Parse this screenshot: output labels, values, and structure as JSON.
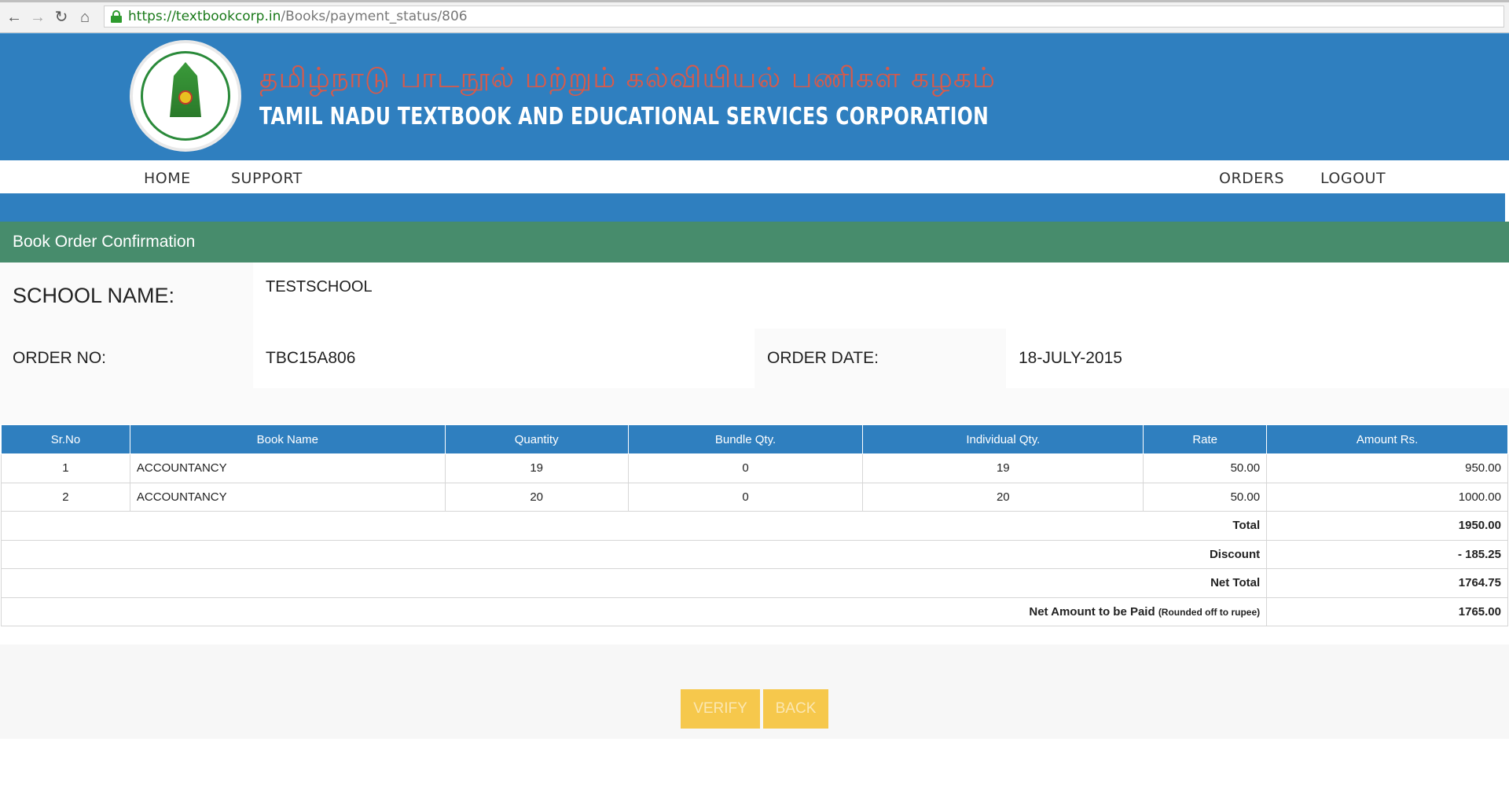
{
  "browser": {
    "url_host": "https://textbookcorp.in",
    "url_path": "/Books/payment_status/806",
    "back_icon": "arrow-left-icon",
    "forward_icon": "arrow-right-icon",
    "reload_icon": "reload-icon",
    "home_icon": "home-icon"
  },
  "header": {
    "title_tamil": "தமிழ்நாடு பாடநூல் மற்றும் கல்வியியல் பணிகள் கழகம்",
    "title_english": "TAMIL NADU TEXTBOOK AND EDUCATIONAL SERVICES CORPORATION"
  },
  "nav": {
    "home": "HOME",
    "support": "SUPPORT",
    "orders": "ORDERS",
    "logout": "LOGOUT"
  },
  "section": {
    "title": "Book Order Confirmation"
  },
  "order": {
    "school_label": "SCHOOL NAME:",
    "school_value": "TESTSCHOOL",
    "order_no_label": "ORDER NO:",
    "order_no_value": "TBC15A806",
    "order_date_label": "ORDER DATE:",
    "order_date_value": "18-JULY-2015"
  },
  "table": {
    "headers": [
      "Sr.No",
      "Book Name",
      "Quantity",
      "Bundle Qty.",
      "Individual Qty.",
      "Rate",
      "Amount Rs."
    ],
    "rows": [
      [
        "1",
        "ACCOUNTANCY",
        "19",
        "0",
        "19",
        "50.00",
        "950.00"
      ],
      [
        "2",
        "ACCOUNTANCY",
        "20",
        "0",
        "20",
        "50.00",
        "1000.00"
      ]
    ],
    "summary": {
      "total_label": "Total",
      "total_value": "1950.00",
      "discount_label": "Discount",
      "discount_value": "- 185.25",
      "net_total_label": "Net Total",
      "net_total_value": "1764.75",
      "net_amount_label": "Net Amount to be Paid",
      "net_amount_note": "(Rounded off to rupee)",
      "net_amount_value": "1765.00"
    }
  },
  "buttons": {
    "verify": "VERIFY",
    "back": "BACK"
  },
  "colors": {
    "header_blue": "#2f7fbf",
    "section_green": "#478c6c",
    "button_yellow": "#f6c84c"
  }
}
